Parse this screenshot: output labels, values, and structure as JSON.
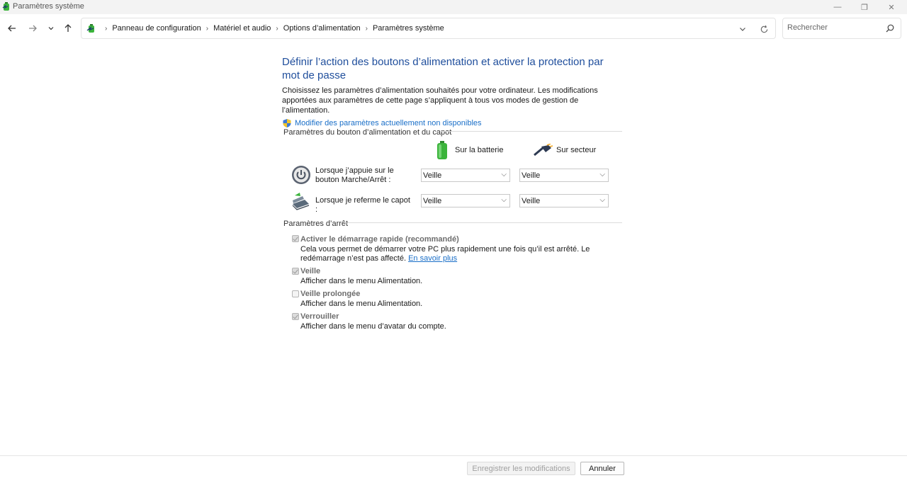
{
  "window": {
    "title": "Paramètres système",
    "minimize_glyph": "—",
    "maximize_glyph": "❐",
    "close_glyph": "✕"
  },
  "nav": {
    "back_icon": "arrow-left-icon",
    "forward_icon": "arrow-right-icon",
    "recent_icon": "chevron-down-icon",
    "up_icon": "arrow-up-icon"
  },
  "breadcrumb": {
    "items": [
      "Panneau de configuration",
      "Matériel et audio",
      "Options d’alimentation",
      "Paramètres système"
    ],
    "separator": "›"
  },
  "search": {
    "placeholder": "Rechercher"
  },
  "main": {
    "heading": "Définir l’action des boutons d’alimentation et activer la protection par mot de passe",
    "description": "Choisissez les paramètres d’alimentation souhaités pour votre ordinateur. Les modifications apportées aux paramètres de cette page s’appliquent à tous vos modes de gestion de l’alimentation.",
    "admin_link": "Modifier des paramètres actuellement non disponibles"
  },
  "power_buttons": {
    "section_title": "Paramètres du bouton d’alimentation et du capot",
    "col_battery": "Sur la batterie",
    "col_ac": "Sur secteur",
    "rows": [
      {
        "label": "Lorsque j’appuie sur le bouton Marche/Arrêt :",
        "battery": "Veille",
        "ac": "Veille"
      },
      {
        "label": "Lorsque je referme le capot :",
        "battery": "Veille",
        "ac": "Veille"
      }
    ]
  },
  "shutdown": {
    "section_title": "Paramètres d’arrêt",
    "options": [
      {
        "label": "Activer le démarrage rapide (recommandé)",
        "checked": true,
        "desc": "Cela vous permet de démarrer votre PC plus rapidement une fois qu’il est arrêté. Le redémarrage n’est pas affecté.",
        "link": "En savoir plus"
      },
      {
        "label": "Veille",
        "checked": true,
        "desc": "Afficher dans le menu Alimentation."
      },
      {
        "label": "Veille prolongée",
        "checked": false,
        "desc": "Afficher dans le menu Alimentation."
      },
      {
        "label": "Verrouiller",
        "checked": true,
        "desc": "Afficher dans le menu d’avatar du compte."
      }
    ]
  },
  "footer": {
    "save_label": "Enregistrer les modifications",
    "cancel_label": "Annuler"
  },
  "colors": {
    "heading": "#1f4e9c",
    "link": "#1a6fc8",
    "battery_green": "#3bb43b"
  }
}
